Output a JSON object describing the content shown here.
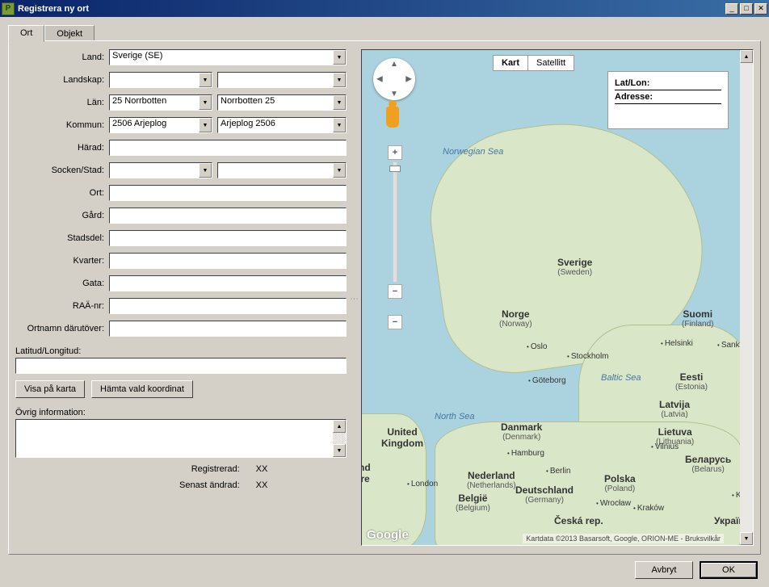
{
  "window": {
    "title": "Registrera ny ort"
  },
  "tabs": {
    "ort": "Ort",
    "objekt": "Objekt"
  },
  "form": {
    "land_label": "Land:",
    "land_value": "Sverige (SE)",
    "landskap_label": "Landskap:",
    "landskap_value_a": "",
    "landskap_value_b": "",
    "lan_label": "Län:",
    "lan_value_a": "25  Norrbotten",
    "lan_value_b": "Norrbotten  25",
    "kommun_label": "Kommun:",
    "kommun_value_a": "2506  Arjeplog",
    "kommun_value_b": "Arjeplog  2506",
    "harad_label": "Härad:",
    "harad_value": "",
    "socken_label": "Socken/Stad:",
    "socken_value_a": "",
    "socken_value_b": "",
    "ort_label": "Ort:",
    "ort_value": "",
    "gard_label": "Gård:",
    "gard_value": "",
    "stadsdel_label": "Stadsdel:",
    "stadsdel_value": "",
    "kvarter_label": "Kvarter:",
    "kvarter_value": "",
    "gata_label": "Gata:",
    "gata_value": "",
    "raa_label": "RAÄ-nr:",
    "raa_value": "",
    "ortnamn_label": "Ortnamn därutöver:",
    "ortnamn_value": "",
    "latlon_label": "Latitud/Longitud:",
    "latlon_value": "",
    "btn_visa": "Visa på karta",
    "btn_hamta": "Hämta vald koordinat",
    "ovrig_label": "Övrig information:",
    "ovrig_value": "",
    "registrerad_label": "Registrerad:",
    "registrerad_value": "XX",
    "senast_label": "Senast ändrad:",
    "senast_value": "XX"
  },
  "map": {
    "type_kart": "Kart",
    "type_sat": "Satellitt",
    "info_latlon": "Lat/Lon:",
    "info_adresse": "Adresse:",
    "google": "Google",
    "attrib": "Kartdata ©2013 Basarsoft, Google, ORION-ME - Bruksvilkår",
    "labels": {
      "norwegian_sea": "Norwegian Sea",
      "north_sea": "North Sea",
      "baltic_sea": "Baltic Sea",
      "sverige": "Sverige",
      "sverige_sub": "(Sweden)",
      "norge": "Norge",
      "norge_sub": "(Norway)",
      "suomi": "Suomi",
      "suomi_sub": "(Finland)",
      "eesti": "Eesti",
      "eesti_sub": "(Estonia)",
      "latvija": "Latvija",
      "latvija_sub": "(Latvia)",
      "lietuva": "Lietuva",
      "lietuva_sub": "(Lithuania)",
      "belarus": "Беларусь",
      "belarus_sub": "(Belarus)",
      "polska": "Polska",
      "polska_sub": "(Poland)",
      "deutschland": "Deutschland",
      "deutschland_sub": "(Germany)",
      "ceska": "Česká rep.",
      "danmark": "Danmark",
      "danmark_sub": "(Denmark)",
      "uk": "United",
      "uk_sub": "Kingdom",
      "nederland": "Nederland",
      "nederland_sub": "(Netherlands)",
      "belgie": "België",
      "belgie_sub": "(Belgium)",
      "eire": "land",
      "eire_sub": "Éire",
      "ukraina": "Україна"
    },
    "cities": {
      "oslo": "Oslo",
      "stockholm": "Stockholm",
      "goteborg": "Göteborg",
      "helsinki": "Helsinki",
      "sankt": "Sankt.",
      "london": "London",
      "hamburg": "Hamburg",
      "berlin": "Berlin",
      "wroclaw": "Wrocław",
      "krakow": "Kraków",
      "kiev": "Kiev",
      "vilnius": "Vilnius"
    }
  },
  "buttons": {
    "avbryt": "Avbryt",
    "ok": "OK"
  }
}
